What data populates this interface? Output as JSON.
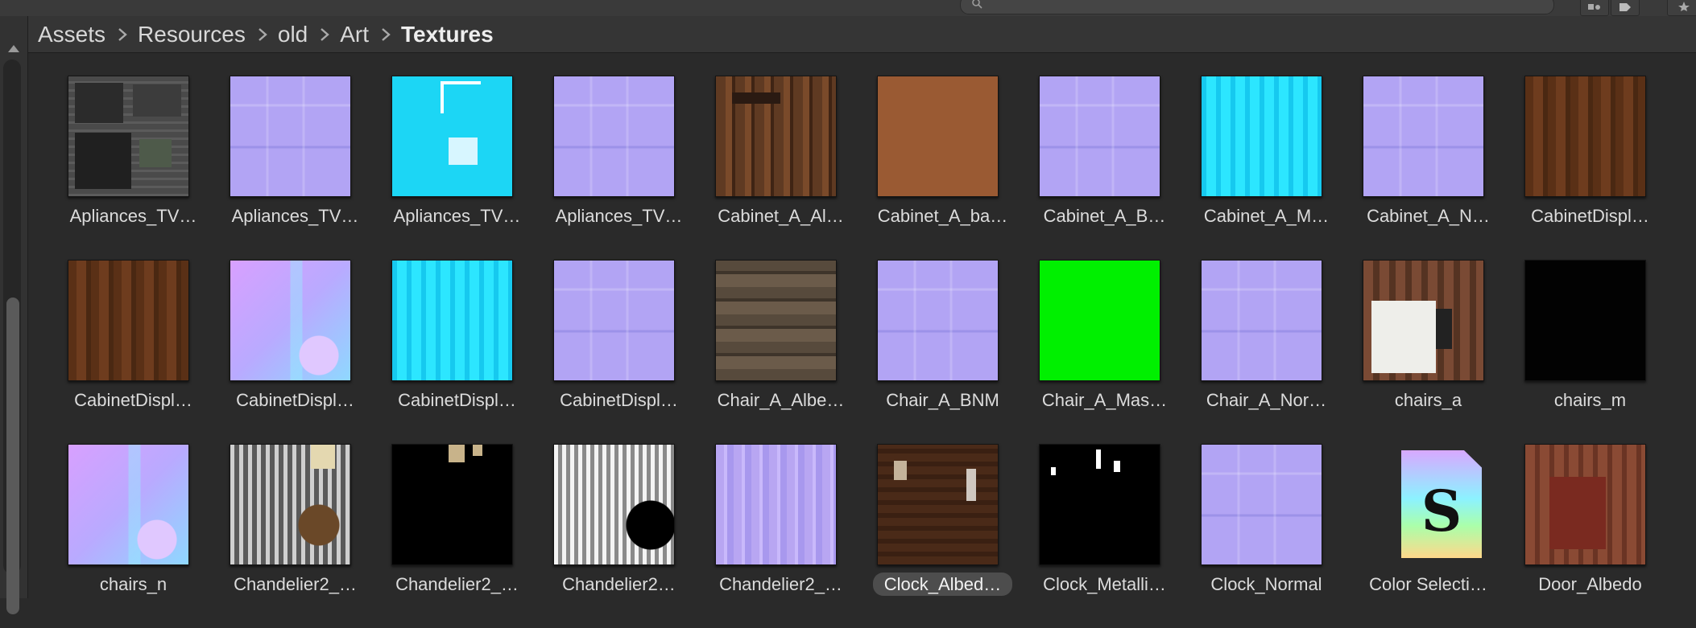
{
  "breadcrumb": [
    "Assets",
    "Resources",
    "old",
    "Art",
    "Textures"
  ],
  "toolbar": {
    "search_placeholder": "",
    "icons": [
      "search-icon",
      "filter-by-type-icon",
      "filter-by-label-icon",
      "favorite-icon"
    ]
  },
  "assets": [
    {
      "label": "Apliances_TV…",
      "texture": "tv"
    },
    {
      "label": "Apliances_TV…",
      "texture": "normal"
    },
    {
      "label": "Apliances_TV…",
      "texture": "cyan"
    },
    {
      "label": "Apliances_TV…",
      "texture": "normal"
    },
    {
      "label": "Cabinet_A_Al…",
      "texture": "wood2"
    },
    {
      "label": "Cabinet_A_ba…",
      "texture": "brown"
    },
    {
      "label": "Cabinet_A_B…",
      "texture": "normal"
    },
    {
      "label": "Cabinet_A_M…",
      "texture": "cyan2"
    },
    {
      "label": "Cabinet_A_N…",
      "texture": "normal"
    },
    {
      "label": "CabinetDispl…",
      "texture": "wood"
    },
    {
      "label": "CabinetDispl…",
      "texture": "wood"
    },
    {
      "label": "CabinetDispl…",
      "texture": "chairsn"
    },
    {
      "label": "CabinetDispl…",
      "texture": "cyan2"
    },
    {
      "label": "CabinetDispl…",
      "texture": "normal"
    },
    {
      "label": "Chair_A_Albe…",
      "texture": "chairA"
    },
    {
      "label": "Chair_A_BNM",
      "texture": "normal"
    },
    {
      "label": "Chair_A_Mas…",
      "texture": "green"
    },
    {
      "label": "Chair_A_Nor…",
      "texture": "normal"
    },
    {
      "label": "chairs_a",
      "texture": "chairs"
    },
    {
      "label": "chairs_m",
      "texture": "black"
    },
    {
      "label": "chairs_n",
      "texture": "chairsn"
    },
    {
      "label": "Chandelier2_…",
      "texture": "chand1"
    },
    {
      "label": "Chandelier2_…",
      "texture": "chand2"
    },
    {
      "label": "Chandelier2…",
      "texture": "chand3"
    },
    {
      "label": "Chandelier2_…",
      "texture": "chand4"
    },
    {
      "label": "Clock_Albed…",
      "texture": "clock",
      "selected": true
    },
    {
      "label": "Clock_Metalli…",
      "texture": "clockm"
    },
    {
      "label": "Clock_Normal",
      "texture": "normal"
    },
    {
      "label": "Color Selecti…",
      "texture": "colorsel"
    },
    {
      "label": "Door_Albedo",
      "texture": "door"
    }
  ]
}
